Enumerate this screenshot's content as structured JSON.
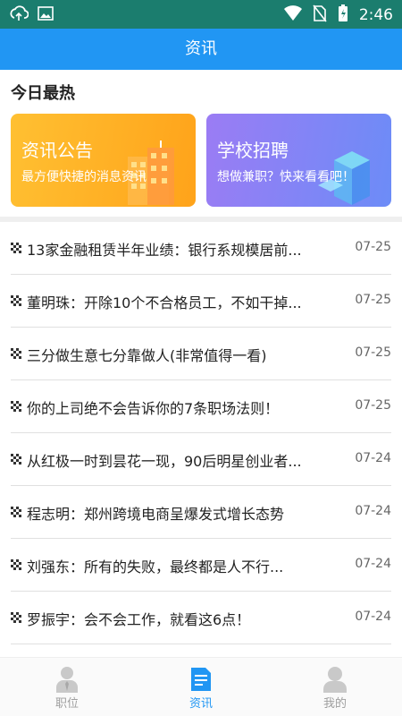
{
  "status_bar": {
    "time": "2:46"
  },
  "app_bar": {
    "title": "资讯"
  },
  "hot": {
    "title": "今日最热",
    "cards": [
      {
        "title": "资讯公告",
        "subtitle": "最方便快捷的消息资讯"
      },
      {
        "title": "学校招聘",
        "subtitle": "想做兼职？快来看看吧！"
      }
    ]
  },
  "news": [
    {
      "title": "13家金融租赁半年业绩：银行系规模居前...",
      "date": "07-25"
    },
    {
      "title": "董明珠：开除10个不合格员工，不如干掉...",
      "date": "07-25"
    },
    {
      "title": "三分做生意七分靠做人(非常值得一看)",
      "date": "07-25"
    },
    {
      "title": "你的上司绝不会告诉你的7条职场法则！",
      "date": "07-25"
    },
    {
      "title": "从红极一时到昙花一现，90后明星创业者...",
      "date": "07-24"
    },
    {
      "title": "程志明：郑州跨境电商呈爆发式增长态势",
      "date": "07-24"
    },
    {
      "title": "刘强东：所有的失败，最终都是人不行...",
      "date": "07-24"
    },
    {
      "title": "罗振宇：会不会工作，就看这6点！",
      "date": "07-24"
    }
  ],
  "tabs": [
    {
      "label": "职位",
      "icon": "person-icon",
      "active": false
    },
    {
      "label": "资讯",
      "icon": "document-icon",
      "active": true
    },
    {
      "label": "我的",
      "icon": "user-icon",
      "active": false
    }
  ],
  "colors": {
    "primary": "#2196f3",
    "status_bar": "#1b7d6e",
    "card_orange": "#ffa31a",
    "card_purple": "#7c7ff5"
  }
}
